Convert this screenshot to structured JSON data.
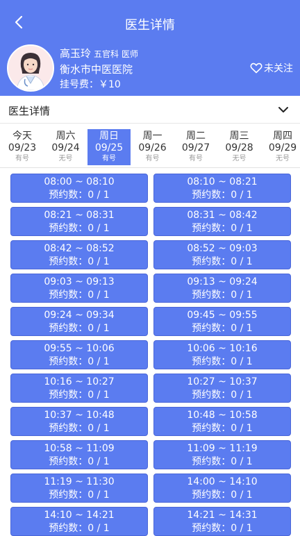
{
  "header": {
    "title": "医生详情"
  },
  "doctor": {
    "name": "高玉玲",
    "dept": "五官科",
    "title": "医师",
    "hospital": "衡水市中医医院",
    "fee": "挂号费：￥10",
    "follow_label": "未关注"
  },
  "detail_label": "医生详情",
  "days": [
    {
      "weekday": "今天",
      "date": "09/23",
      "status": "有号",
      "active": false
    },
    {
      "weekday": "周六",
      "date": "09/24",
      "status": "无号",
      "active": false
    },
    {
      "weekday": "周日",
      "date": "09/25",
      "status": "有号",
      "active": true
    },
    {
      "weekday": "周一",
      "date": "09/26",
      "status": "有号",
      "active": false
    },
    {
      "weekday": "周二",
      "date": "09/27",
      "status": "有号",
      "active": false
    },
    {
      "weekday": "周三",
      "date": "09/28",
      "status": "无号",
      "active": false
    },
    {
      "weekday": "周四",
      "date": "09/29",
      "status": "无号",
      "active": false
    }
  ],
  "count_label": "预约数：0 / 1",
  "slots": [
    [
      "08:00 ~ 08:10",
      "08:10 ~ 08:21"
    ],
    [
      "08:21 ~ 08:31",
      "08:31 ~ 08:42"
    ],
    [
      "08:42 ~ 08:52",
      "08:52 ~ 09:03"
    ],
    [
      "09:03 ~ 09:13",
      "09:13 ~ 09:24"
    ],
    [
      "09:24 ~ 09:34",
      "09:45 ~ 09:55"
    ],
    [
      "09:55 ~ 10:06",
      "10:06 ~ 10:16"
    ],
    [
      "10:16 ~ 10:27",
      "10:27 ~ 10:37"
    ],
    [
      "10:37 ~ 10:48",
      "10:48 ~ 10:58"
    ],
    [
      "10:58 ~ 11:09",
      "11:09 ~ 11:19"
    ],
    [
      "11:19 ~ 11:30",
      "14:00 ~ 14:10"
    ],
    [
      "14:10 ~ 14:21",
      "14:21 ~ 14:31"
    ]
  ],
  "colors": {
    "accent": "#5b7cf0",
    "text": "#333333",
    "muted": "#999999"
  }
}
